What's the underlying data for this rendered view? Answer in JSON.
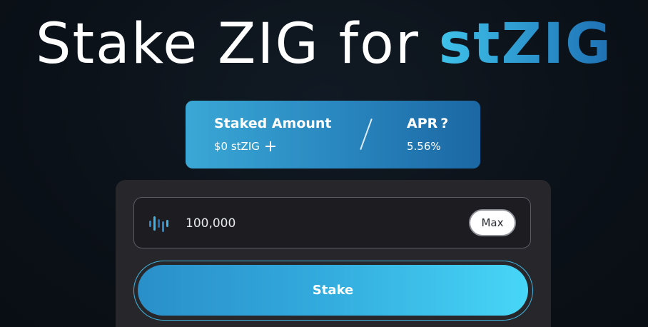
{
  "header": {
    "title_prefix": "Stake ZIG for ",
    "title_accent": "stZIG"
  },
  "stats": {
    "staked_label": "Staked Amount",
    "staked_value": "$0 stZIG",
    "apr_label": "APR",
    "apr_help": "?",
    "apr_value": "5.56%"
  },
  "stake_form": {
    "token_icon": "zig-token-icon",
    "amount_value": "100,000",
    "max_label": "Max",
    "stake_label": "Stake"
  },
  "colors": {
    "accent_start": "#3fc3ea",
    "accent_end": "#1f70b3",
    "panel": "#27272b",
    "background": "#0c121a"
  }
}
